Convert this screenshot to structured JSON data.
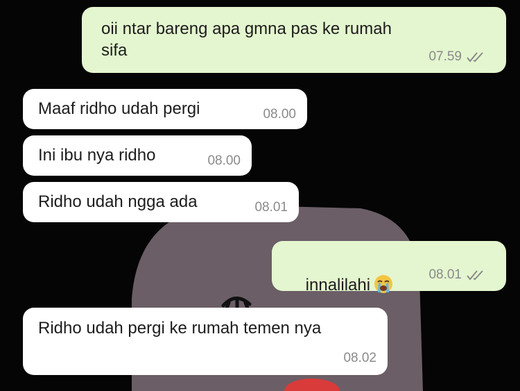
{
  "messages": [
    {
      "direction": "outgoing",
      "text": "oii ntar bareng apa gmna pas ke rumah\nsifa",
      "time": "07.59",
      "status": "read"
    },
    {
      "direction": "incoming",
      "text": "Maaf ridho udah pergi",
      "time": "08.00"
    },
    {
      "direction": "incoming",
      "text": "Ini ibu nya ridho",
      "time": "08.00"
    },
    {
      "direction": "incoming",
      "text": "Ridho udah ngga ada",
      "time": "08.01"
    },
    {
      "direction": "outgoing",
      "text": "innalilahi",
      "emoji": "loudly-crying-face",
      "time": "08.01",
      "status": "read"
    },
    {
      "direction": "incoming",
      "text": "Ridho udah pergi ke rumah temen nya",
      "time": "08.02"
    }
  ],
  "colors": {
    "background": "#050505",
    "outgoing_bubble": "#e4f6cf",
    "incoming_bubble": "#ffffff",
    "meta_text": "#8a8a8a",
    "wallpaper_figure": "#6b5e66"
  }
}
